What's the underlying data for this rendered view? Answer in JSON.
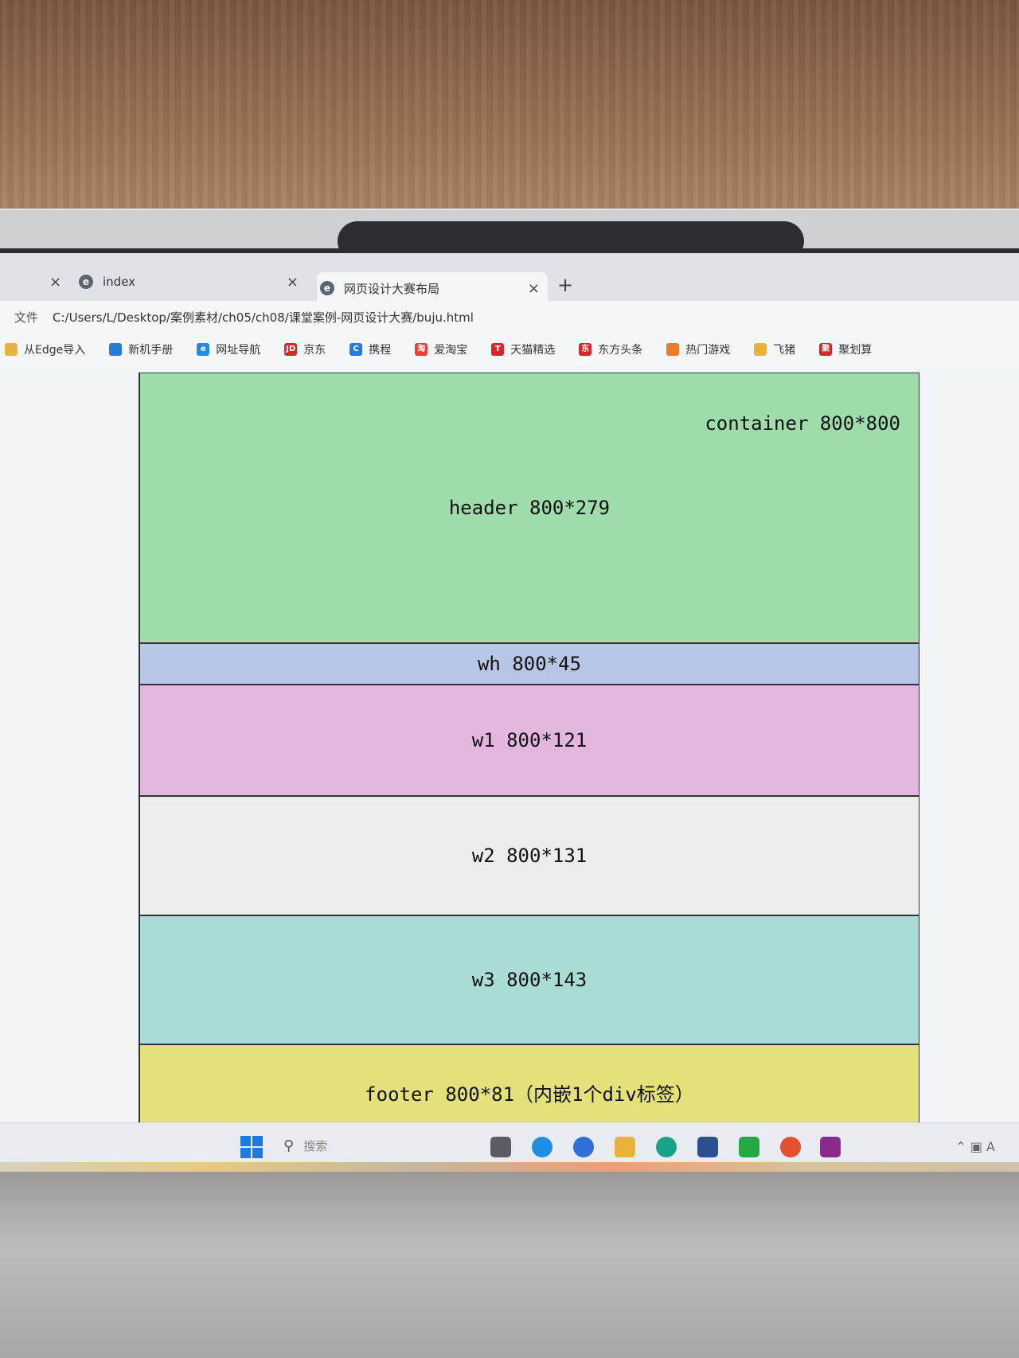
{
  "tabs": {
    "prev_close": "×",
    "tab1": {
      "label": "index",
      "icon": "edge-icon"
    },
    "tab2": {
      "label": "网页设计大赛布局",
      "close": "×",
      "icon": "edge-icon"
    },
    "tab1_close": "×",
    "new_tab": "+"
  },
  "address": {
    "label": "文件",
    "url": "C:/Users/L/Desktop/案例素材/ch05/ch08/课堂案例-网页设计大赛/buju.html"
  },
  "favorites": [
    {
      "label": "从Edge导入",
      "icon": "folder-icon",
      "color": "#e8b33c",
      "glyph": ""
    },
    {
      "label": "新机手册",
      "icon": "manual-icon",
      "color": "#2a7bd4",
      "glyph": ""
    },
    {
      "label": "网址导航",
      "icon": "edge-icon",
      "color": "#1f8de0",
      "glyph": "e"
    },
    {
      "label": "京东",
      "icon": "jd-icon",
      "color": "#d9262b",
      "glyph": "JD"
    },
    {
      "label": "携程",
      "icon": "ctrip-icon",
      "color": "#2a7bd4",
      "glyph": "C"
    },
    {
      "label": "爱淘宝",
      "icon": "taobao-icon",
      "color": "#e8403a",
      "glyph": "淘"
    },
    {
      "label": "天猫精选",
      "icon": "tmall-icon",
      "color": "#d9262b",
      "glyph": "T"
    },
    {
      "label": "东方头条",
      "icon": "dftt-icon",
      "color": "#d9262b",
      "glyph": "东方"
    },
    {
      "label": "热门游戏",
      "icon": "game-icon",
      "color": "#ec7b2c",
      "glyph": ""
    },
    {
      "label": "飞猪",
      "icon": "fliggy-icon",
      "color": "#e8b33c",
      "glyph": ""
    },
    {
      "label": "聚划算",
      "icon": "juhuasuan-icon",
      "color": "#d9262b",
      "glyph": "聚"
    }
  ],
  "layout": {
    "container": "container 800*800",
    "header": "header 800*279",
    "wh": "wh 800*45",
    "w1": "w1 800*121",
    "w2": "w2 800*131",
    "w3": "w3 800*143",
    "footer": "footer 800*81（内嵌1个div标签）"
  },
  "taskbar": {
    "search_placeholder": "搜索"
  },
  "colors": {
    "header": "#9fdcab",
    "wh": "#b7c6e6",
    "w1": "#e3b6e0",
    "w2": "#eceded",
    "w3": "#a8dcd5",
    "footer": "#e4e07a"
  }
}
